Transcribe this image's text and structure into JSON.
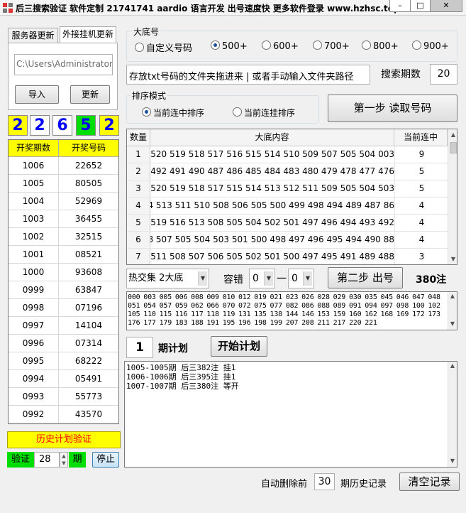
{
  "window": {
    "title": "后三搜索验证 软件定制 21741741 aardio 语言开发 出号速度快 更多软件登录 www.hzhsc.top",
    "min": "–",
    "max": "□",
    "close": "✕"
  },
  "left_tabs": [
    {
      "label": "服务器更新"
    },
    {
      "label": "外接挂机更新"
    }
  ],
  "path_input": {
    "value": "C:\\Users\\Administrator\\"
  },
  "left_buttons": {
    "import": "导入",
    "update": "更新"
  },
  "digits": [
    "2",
    "2",
    "6",
    "5",
    "2"
  ],
  "draw_table": {
    "headers": [
      "开奖期数",
      "开奖号码"
    ],
    "rows": [
      [
        "1006",
        "22652"
      ],
      [
        "1005",
        "80505"
      ],
      [
        "1004",
        "52969"
      ],
      [
        "1003",
        "36455"
      ],
      [
        "1002",
        "32515"
      ],
      [
        "1001",
        "08521"
      ],
      [
        "1000",
        "93608"
      ],
      [
        "0999",
        "63847"
      ],
      [
        "0998",
        "07196"
      ],
      [
        "0997",
        "14104"
      ],
      [
        "0996",
        "07314"
      ],
      [
        "0995",
        "68222"
      ],
      [
        "0994",
        "05491"
      ],
      [
        "0993",
        "55773"
      ],
      [
        "0992",
        "43570"
      ]
    ]
  },
  "history_verify": {
    "button": "历史计划验证",
    "verify_label": "验证",
    "verify_value": "28",
    "period_label": "期",
    "stop": "停止"
  },
  "base": {
    "legend": "大底号",
    "options": [
      "自定义号码",
      "500+",
      "600+",
      "700+",
      "800+",
      "900+"
    ],
    "selected": "500+"
  },
  "folder_input": {
    "value": "存放txt号码的文件夹拖进来 | 或者手动输入文件夹路径"
  },
  "search": {
    "label": "搜索期数",
    "value": "20"
  },
  "sort": {
    "legend": "排序模式",
    "options": [
      "当前连中排序",
      "当前连挂排序"
    ],
    "selected": "当前连中排序"
  },
  "step1": "第一步 读取号码",
  "number_table": {
    "headers": [
      "数量",
      "大底内容",
      "当前连中"
    ],
    "rows": [
      [
        "1",
        "003 504 505 507 509 510 514 515 516 517 518 519 520 521",
        "9"
      ],
      [
        "2",
        "476 477 478 479 480 483 484 485 486 487 490 491 492 4",
        "5"
      ],
      [
        "3",
        "503 504 505 509 511 512 513 514 515 517 518 519 520 5",
        "5"
      ],
      [
        "4",
        "86 487 489 494 498 499 500 505 506 508 510 511 513 514",
        "4"
      ],
      [
        "5",
        "492 493 494 496 497 501 502 504 505 508 513 516 519 5",
        "4"
      ],
      [
        "6",
        "88 490 494 495 496 497 498 500 501 503 504 505 507 508",
        "4"
      ],
      [
        "7",
        "488 489 491 495 497 500 501 502 505 506 507 508 511 5",
        "3"
      ]
    ]
  },
  "step2": {
    "hot_select": "热交集 2大底",
    "tolerance_label": "容错",
    "tol_from": "0",
    "dash": "一",
    "tol_to": "0",
    "button": "第二步 出号",
    "note_count": "380注"
  },
  "numbers_text": "000 003 005 006 008 009 010 012 019 021 023 026 028 029 030 035 045 046 047 048 051 054 057 059 062 066 070 072 075 077 082 086 088 089 091 094 097 098 100 102 105 110 115 116 117 118 119 131 135 138 144 146 153 159 160 162 168 169 172 173 176 177 179 183 188 191 195 196 198 199 207 208 211 217 220 221",
  "plan": {
    "count": "1",
    "label": "期计划",
    "button": "开始计划",
    "lines": [
      "1005-1005期 后三382注 挂1",
      "1006-1006期 后三395注 挂1",
      "1007-1007期 后三380注 等开"
    ]
  },
  "footer": {
    "auto_delete_label": "自动删除前",
    "auto_delete_value": "30",
    "history_label": "期历史记录",
    "clear_button": "清空记录"
  },
  "colors": {
    "yellow": "#ffff00",
    "green": "#00dd00",
    "digit_blue": "#0000ff",
    "warn_red": "#ff0000"
  }
}
